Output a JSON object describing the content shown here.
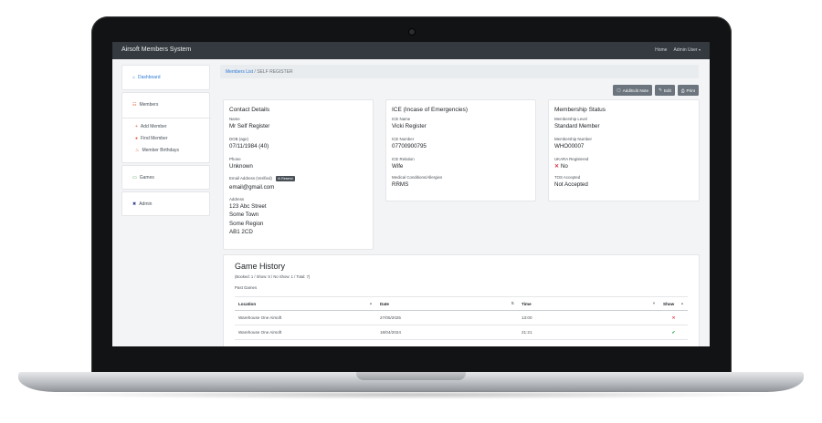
{
  "app": {
    "brand": "Airsoft Members System"
  },
  "nav": {
    "home": "Home",
    "admin_user": "Admin User"
  },
  "sidebar": {
    "dashboard": "Dashboard",
    "members": "Members",
    "members_sub": [
      "Add Member",
      "Find Member",
      "Member Birthdays"
    ],
    "games": "Games",
    "admin": "Admin"
  },
  "breadcrumb": {
    "parent": "Members List",
    "separator": "/",
    "current": "SELF REGISTER"
  },
  "actions": {
    "add_edit_note": "Add/Edit Note",
    "edit": "Edit",
    "print": "Print"
  },
  "contact": {
    "title": "Contact Details",
    "name_label": "Name",
    "name": "Mr Self Register",
    "dob_label": "DOB (age)",
    "dob": "07/11/1984 (40)",
    "phone_label": "Phone",
    "phone": "Unknown",
    "email_label": "Email Address (Verified)",
    "email_badge": "Resend",
    "email": "email@gmail.com",
    "address_label": "Address",
    "address_lines": [
      "123 Abc Street",
      "Some Town",
      "Some Region",
      "AB1 2CD"
    ]
  },
  "ice": {
    "title": "ICE (Incase of Emergencies)",
    "name_label": "ICE Name",
    "name": "Vicki Register",
    "number_label": "ICE Number",
    "number": "07700900795",
    "relation_label": "ICE Relation",
    "relation": "Wife",
    "medical_label": "Medical Conditions/Allergies",
    "medical": "RRMS"
  },
  "membership": {
    "title": "Membership Status",
    "level_label": "Membership Level",
    "level": "Standard Member",
    "number_label": "Membership Number",
    "number": "WHO00007",
    "ukara_label": "UKARA Registered",
    "ukara": "No",
    "tos_label": "TOS Accepted",
    "tos": "Not Accepted"
  },
  "game_history": {
    "title": "Game History",
    "summary": "(Booked: 1 / Show: 5 / No Show: 1 / Total: 7)",
    "past_label": "Past Games",
    "columns": [
      "Location",
      "Date",
      "Time",
      "Show"
    ],
    "rows": [
      {
        "location": "Warehouse One Airsoft",
        "date": "27/05/2025",
        "time": "13:00",
        "show": false
      },
      {
        "location": "Warehouse One Airsoft",
        "date": "18/04/2024",
        "time": "21:21",
        "show": true
      }
    ]
  },
  "colors": {
    "navbar": "#343a40",
    "link": "#2f7bd5",
    "button": "#6c757d",
    "cross": "#dc3545",
    "tick": "#28a745"
  }
}
